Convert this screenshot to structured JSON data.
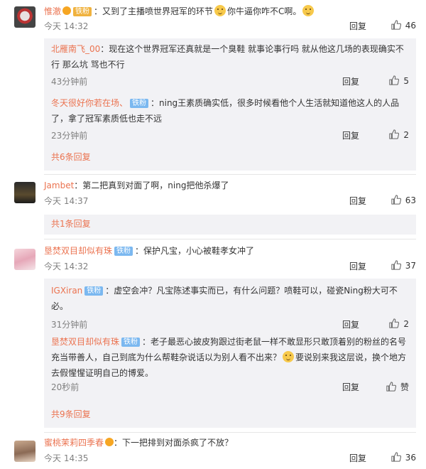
{
  "like_label_zan": "赞",
  "reply_label": "回复",
  "comments": [
    {
      "user": "惟澈",
      "badge": "铁粉",
      "content": "：又到了主播喷世界冠军的环节",
      "content2": "你牛逼你咋不C啊。",
      "time": "今天 14:32",
      "likes": "46",
      "replies": [
        {
          "user": "北雁南飞_00",
          "content": "：现在这个世界冠军还真就是一个臭鞋 就事论事行吗 就从他这几场的表现确实不行 那么坑 骂也不行",
          "time": "43分钟前",
          "likes": "5"
        },
        {
          "user": "冬天很好你若在场、",
          "badge": "铁粉",
          "content": "：ning王素质确实低，很多时候看他个人生活就知道他这人的人品了，拿了冠军素质低也走不远",
          "time": "23分钟前",
          "likes": "2"
        }
      ],
      "expand": "共6条回复"
    },
    {
      "user": "Jambet",
      "content": "：第二把真到对面了啊，ning把他杀爆了",
      "time": "今天 14:37",
      "likes": "63",
      "expand": "共1条回复"
    },
    {
      "user": "垦焚双目却似有珠",
      "badge": "铁粉",
      "content": "：保护凡宝，小心被鞋孝女冲了",
      "time": "今天 14:32",
      "likes": "37",
      "replies": [
        {
          "user": "IGXiran",
          "badge": "铁粉",
          "content": "：虚空会冲？凡宝陈述事实而已，有什么问题？喷鞋可以，碰瓷Ning粉大可不必。",
          "time": "31分钟前",
          "likes": "2"
        },
        {
          "user": "垦焚双目却似有珠",
          "badge": "铁粉",
          "content": "：老子最恶心披皮狗跟过街老鼠一样不敢显形只敢顶着别的粉丝的名号充当带善人，自己到底为什么帮鞋杂说话以为别人看不出来？",
          "content2": "要说别来我这层说，换个地方去假惺惺证明自己的博爱。",
          "time": "20秒前",
          "likes": "赞"
        }
      ],
      "expand": "共9条回复"
    },
    {
      "user": "蜜桃茉莉四季春",
      "content": "：下一把排到对面杀疯了不放？",
      "time": "今天 14:35",
      "likes": "36"
    }
  ]
}
